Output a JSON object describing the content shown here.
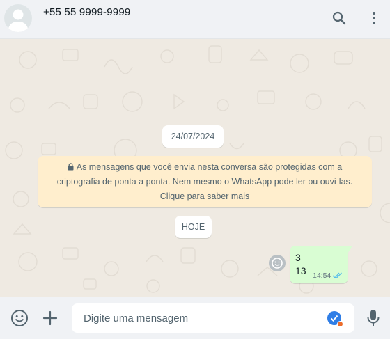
{
  "header": {
    "contact_name": "+55 55 9999-9999",
    "avatar_icon": "default-user-avatar-icon",
    "search_icon": "search-icon",
    "menu_icon": "kebab-menu-icon"
  },
  "chat": {
    "date_divider": "24/07/2024",
    "encryption_notice": {
      "icon": "lock-icon",
      "text": "As mensagens que você envia nesta conversa são protegidas com a criptografia de ponta a ponta. Nem mesmo o WhatsApp pode ler ou ouvi-las. Clique para saber mais"
    },
    "today_divider": "HOJE",
    "messages": [
      {
        "direction": "outgoing",
        "lines": [
          "3",
          "13"
        ],
        "time": "14:54",
        "status": "read",
        "status_icon": "double-check-icon",
        "reaction_icon": "emoji-reaction-icon"
      }
    ]
  },
  "composer": {
    "emoji_icon": "smiley-icon",
    "attach_icon": "plus-icon",
    "placeholder": "Digite uma mensagem",
    "value": "",
    "extension_badge_icon": "grammar-check-icon",
    "mic_icon": "microphone-icon"
  },
  "colors": {
    "header_bg": "#f0f2f5",
    "chat_bg": "#efeae2",
    "outgoing_bubble": "#d9fdd3",
    "notice_bg": "#ffeecd",
    "read_ticks": "#53bdeb",
    "icon_gray": "#54656f"
  }
}
